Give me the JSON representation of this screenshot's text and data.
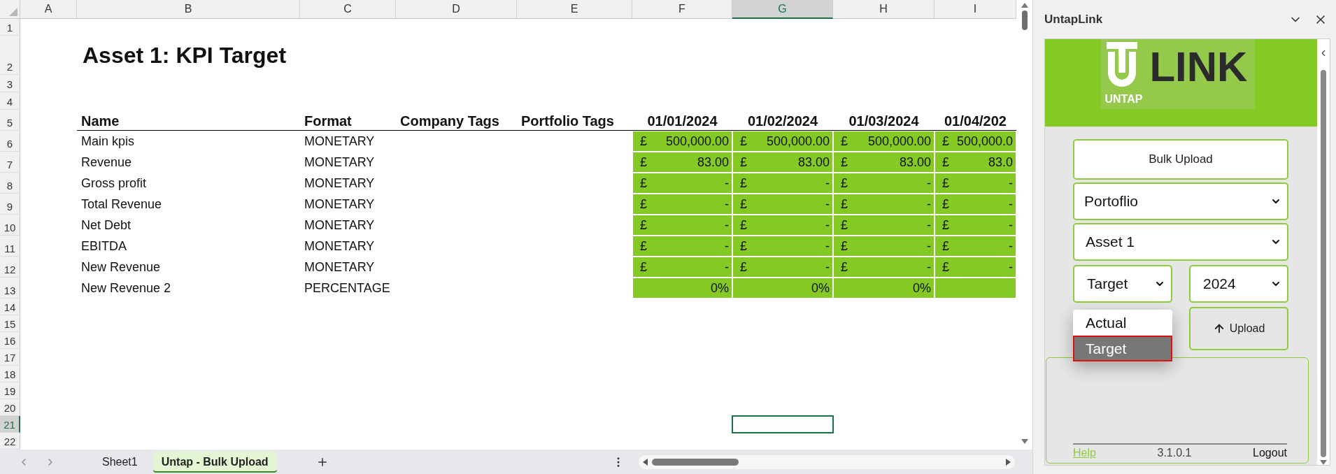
{
  "sheet": {
    "column_headers": [
      {
        "label": "A",
        "selected": false
      },
      {
        "label": "B",
        "selected": false
      },
      {
        "label": "C",
        "selected": false
      },
      {
        "label": "D",
        "selected": false
      },
      {
        "label": "E",
        "selected": false
      },
      {
        "label": "F",
        "selected": false
      },
      {
        "label": "G",
        "selected": true
      },
      {
        "label": "H",
        "selected": false
      },
      {
        "label": "I",
        "selected": false
      }
    ],
    "row_numbers": [
      {
        "label": "1",
        "selected": false
      },
      {
        "label": "2",
        "selected": false
      },
      {
        "label": "3",
        "selected": false
      },
      {
        "label": "4",
        "selected": false
      },
      {
        "label": "5",
        "selected": false
      },
      {
        "label": "6",
        "selected": false
      },
      {
        "label": "7",
        "selected": false
      },
      {
        "label": "8",
        "selected": false
      },
      {
        "label": "9",
        "selected": false
      },
      {
        "label": "10",
        "selected": false
      },
      {
        "label": "11",
        "selected": false
      },
      {
        "label": "12",
        "selected": false
      },
      {
        "label": "13",
        "selected": false
      },
      {
        "label": "14",
        "selected": false
      },
      {
        "label": "15",
        "selected": false
      },
      {
        "label": "16",
        "selected": false
      },
      {
        "label": "17",
        "selected": false
      },
      {
        "label": "18",
        "selected": false
      },
      {
        "label": "19",
        "selected": false
      },
      {
        "label": "20",
        "selected": false
      },
      {
        "label": "21",
        "selected": true
      },
      {
        "label": "22",
        "selected": false
      }
    ],
    "title": "Asset 1: KPI Target",
    "table": {
      "columns": [
        "Name",
        "Format",
        "Company Tags",
        "Portfolio Tags",
        "01/01/2024",
        "01/02/2024",
        "01/03/2024",
        "01/04/202"
      ],
      "rows": [
        {
          "name": "Main kpis",
          "format": "MONETARY",
          "values": [
            {
              "currency": "£",
              "amount": "500,000.00"
            },
            {
              "currency": "£",
              "amount": "500,000.00"
            },
            {
              "currency": "£",
              "amount": "500,000.00"
            },
            {
              "currency": "£",
              "amount": "500,000.0"
            }
          ]
        },
        {
          "name": "Revenue",
          "format": "MONETARY",
          "values": [
            {
              "currency": "£",
              "amount": "83.00"
            },
            {
              "currency": "£",
              "amount": "83.00"
            },
            {
              "currency": "£",
              "amount": "83.00"
            },
            {
              "currency": "£",
              "amount": "83.0"
            }
          ]
        },
        {
          "name": "Gross profit",
          "format": "MONETARY",
          "values": [
            {
              "currency": "£",
              "amount": "-"
            },
            {
              "currency": "£",
              "amount": "-"
            },
            {
              "currency": "£",
              "amount": "-"
            },
            {
              "currency": "£",
              "amount": "-"
            }
          ]
        },
        {
          "name": "Total Revenue",
          "format": "MONETARY",
          "values": [
            {
              "currency": "£",
              "amount": "-"
            },
            {
              "currency": "£",
              "amount": "-"
            },
            {
              "currency": "£",
              "amount": "-"
            },
            {
              "currency": "£",
              "amount": "-"
            }
          ]
        },
        {
          "name": "Net Debt",
          "format": "MONETARY",
          "values": [
            {
              "currency": "£",
              "amount": "-"
            },
            {
              "currency": "£",
              "amount": "-"
            },
            {
              "currency": "£",
              "amount": "-"
            },
            {
              "currency": "£",
              "amount": "-"
            }
          ]
        },
        {
          "name": "EBITDA",
          "format": "MONETARY",
          "values": [
            {
              "currency": "£",
              "amount": "-"
            },
            {
              "currency": "£",
              "amount": "-"
            },
            {
              "currency": "£",
              "amount": "-"
            },
            {
              "currency": "£",
              "amount": "-"
            }
          ]
        },
        {
          "name": "New Revenue",
          "format": "MONETARY",
          "values": [
            {
              "currency": "£",
              "amount": "-"
            },
            {
              "currency": "£",
              "amount": "-"
            },
            {
              "currency": "£",
              "amount": "-"
            },
            {
              "currency": "£",
              "amount": "-"
            }
          ]
        },
        {
          "name": "New Revenue 2",
          "format": "PERCENTAGE",
          "values": [
            {
              "amount": "0%"
            },
            {
              "amount": "0%"
            },
            {
              "amount": "0%"
            }
          ]
        }
      ]
    }
  },
  "sheet_tabs": [
    {
      "label": "Sheet1",
      "selected": false
    },
    {
      "label": "Untap - Bulk Upload",
      "selected": true
    }
  ],
  "panel": {
    "title": "UntapLink",
    "logo": {
      "wordmark": "LINK",
      "tagline": "UNTAP"
    },
    "bulk_upload_button": "Bulk Upload",
    "portfolio_select": {
      "value": "Portoflio"
    },
    "asset_select": {
      "value": "Asset 1"
    },
    "type_select": {
      "value": "Target",
      "expanded": true,
      "options": [
        {
          "label": "Actual",
          "selected": false
        },
        {
          "label": "Target",
          "selected": true
        }
      ]
    },
    "year_select": {
      "value": "2024"
    },
    "upload_button": "Upload",
    "footer": {
      "help_link": "Help",
      "version": "3.1.0.1",
      "logout": "Logout"
    }
  }
}
